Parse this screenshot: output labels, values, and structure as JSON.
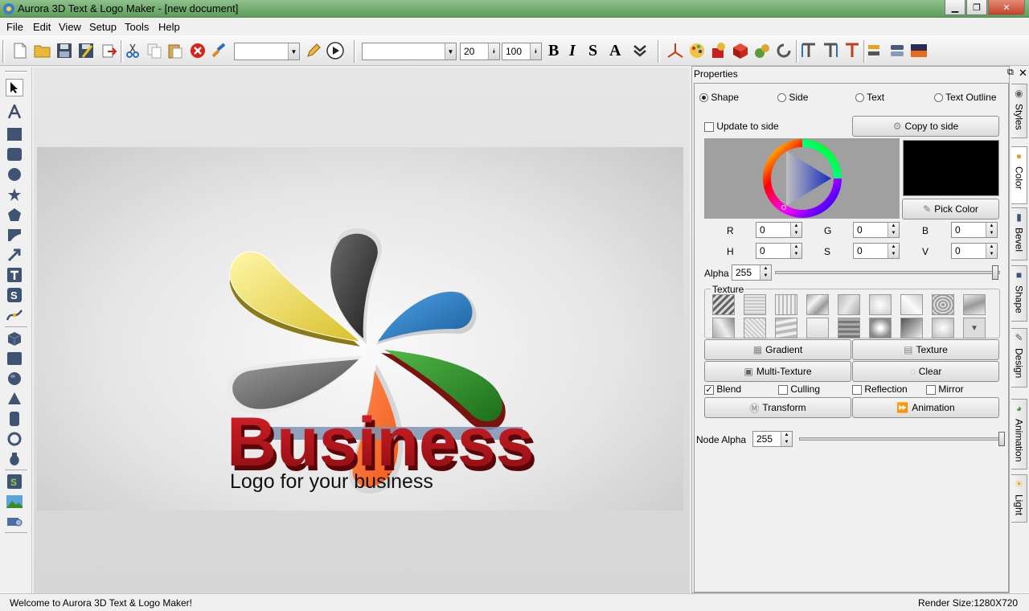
{
  "window": {
    "title": "Aurora 3D Text & Logo Maker - [new document]"
  },
  "menu": [
    "File",
    "Edit",
    "View",
    "Setup",
    "Tools",
    "Help"
  ],
  "toolbar": {
    "font_size": "20",
    "scale": "100",
    "bold": "B",
    "italic": "I",
    "s_label": "S",
    "a_label": "A"
  },
  "scene": {
    "title_text": "Business",
    "subtitle_text": "Logo for your business",
    "petal_colors": [
      "#e8d84a",
      "#3a3a3a",
      "#2c7fc4",
      "#2e8f2b",
      "#ff6a2e",
      "#6e6e6e"
    ],
    "title_color": "#b01218"
  },
  "properties": {
    "header": "Properties",
    "radios": [
      {
        "label": "Shape",
        "selected": true
      },
      {
        "label": "Side",
        "selected": false
      },
      {
        "label": "Text",
        "selected": false
      },
      {
        "label": "Text Outline",
        "selected": false
      }
    ],
    "update_to_side": "Update to side",
    "copy_to_side": "Copy to side",
    "pick_color": "Pick Color",
    "current_color": "#000000",
    "r_label": "R",
    "g_label": "G",
    "b_label": "B",
    "h_label": "H",
    "s_label": "S",
    "v_label": "V",
    "r": "0",
    "g": "0",
    "b": "0",
    "h": "0",
    "s": "0",
    "v": "0",
    "alpha_label": "Alpha",
    "alpha": "255",
    "texture_label": "Texture",
    "buttons": {
      "gradient": "Gradient",
      "texture": "Texture",
      "multi_texture": "Multi-Texture",
      "clear": "Clear",
      "transform": "Transform",
      "animation": "Animation"
    },
    "checks": [
      {
        "label": "Blend",
        "checked": true
      },
      {
        "label": "Culling",
        "checked": false
      },
      {
        "label": "Reflection",
        "checked": false
      },
      {
        "label": "Mirror",
        "checked": false
      }
    ],
    "node_alpha_label": "Node Alpha",
    "node_alpha": "255"
  },
  "side_tabs": [
    "Styles",
    "Color",
    "Bevel",
    "Shape",
    "Design",
    "Animation",
    "Light"
  ],
  "status": {
    "message": "Welcome to Aurora 3D Text & Logo Maker!",
    "render_size": "Render Size:1280X720"
  }
}
